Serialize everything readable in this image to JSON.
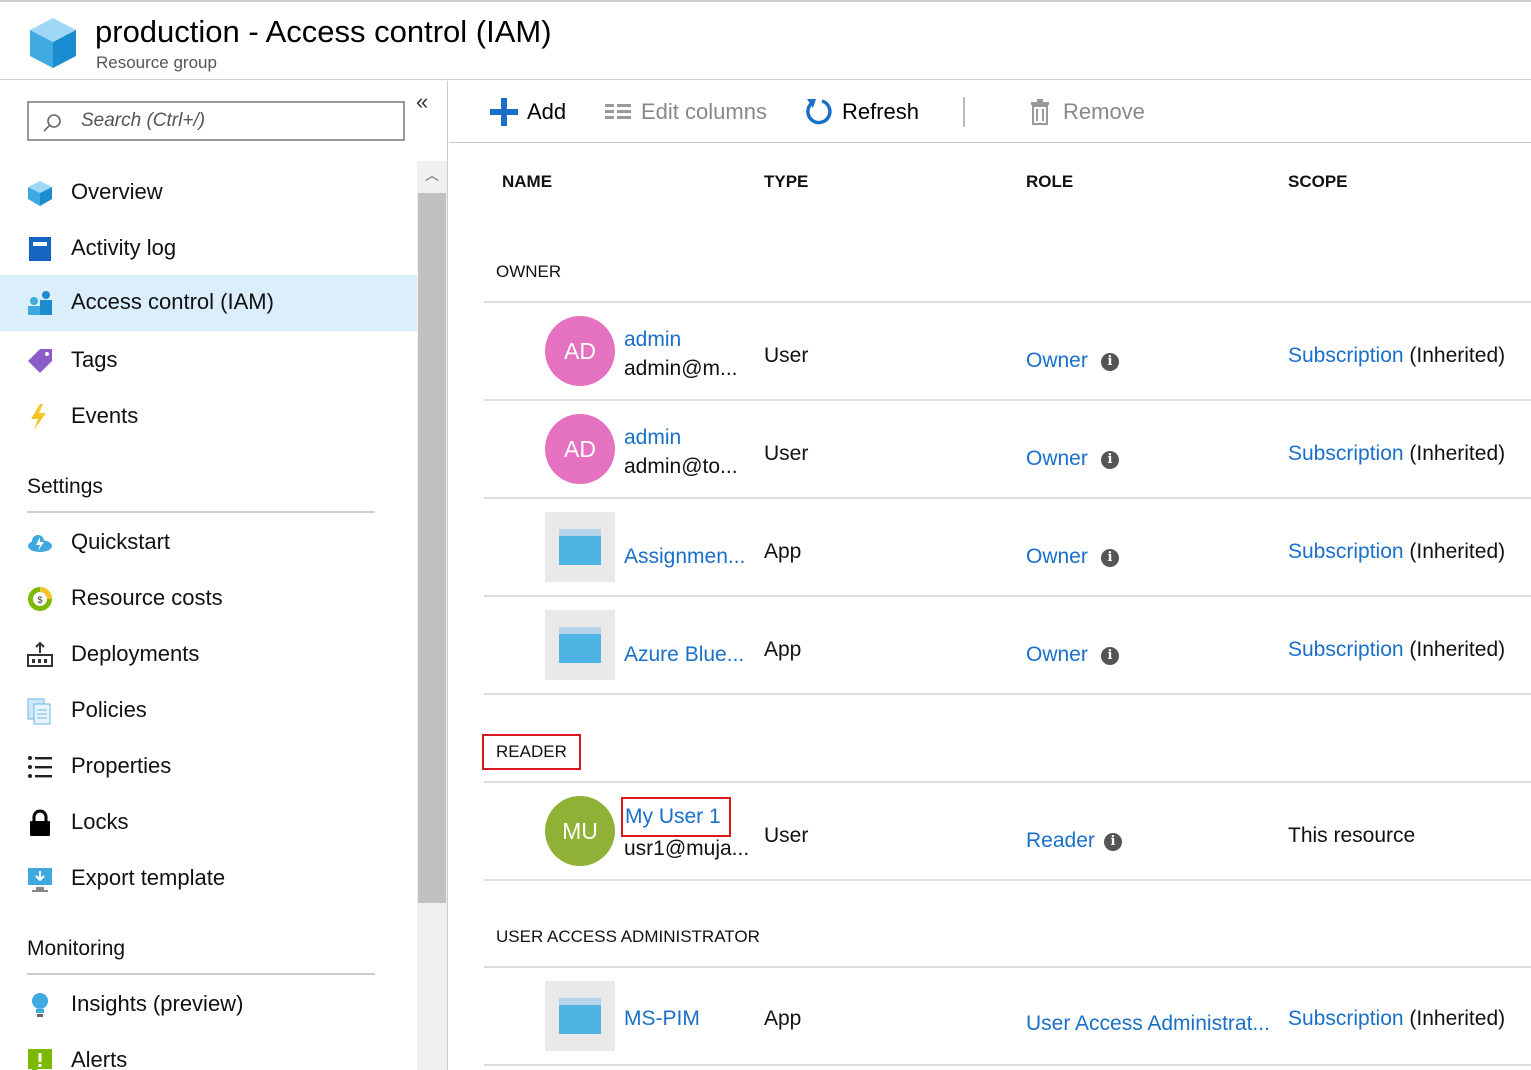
{
  "header": {
    "title": "production - Access control (IAM)",
    "subtitle": "Resource group"
  },
  "search": {
    "placeholder": "Search (Ctrl+/)"
  },
  "sidebar": {
    "items": [
      {
        "label": "Overview",
        "icon": "cube-icon"
      },
      {
        "label": "Activity log",
        "icon": "activity-log-icon"
      },
      {
        "label": "Access control (IAM)",
        "icon": "people-icon",
        "active": true
      },
      {
        "label": "Tags",
        "icon": "tag-icon"
      },
      {
        "label": "Events",
        "icon": "lightning-icon"
      }
    ],
    "settings_heading": "Settings",
    "settings_items": [
      {
        "label": "Quickstart",
        "icon": "cloud-icon"
      },
      {
        "label": "Resource costs",
        "icon": "costs-icon"
      },
      {
        "label": "Deployments",
        "icon": "deployments-icon"
      },
      {
        "label": "Policies",
        "icon": "policies-icon"
      },
      {
        "label": "Properties",
        "icon": "list-icon"
      },
      {
        "label": "Locks",
        "icon": "lock-icon"
      },
      {
        "label": "Export template",
        "icon": "export-icon"
      }
    ],
    "monitoring_heading": "Monitoring",
    "monitoring_items": [
      {
        "label": "Insights (preview)",
        "icon": "lightbulb-icon"
      },
      {
        "label": "Alerts",
        "icon": "alert-icon"
      }
    ]
  },
  "toolbar": {
    "add": "Add",
    "edit_columns": "Edit columns",
    "refresh": "Refresh",
    "remove": "Remove"
  },
  "table": {
    "headers": {
      "name": "NAME",
      "type": "TYPE",
      "role": "ROLE",
      "scope": "SCOPE"
    },
    "groups": [
      {
        "label": "OWNER",
        "rows": [
          {
            "avatar": "AD",
            "name": "admin",
            "sub": "admin@m...",
            "type": "User",
            "role": "Owner",
            "scope_link": "Subscription",
            "scope_note": "(Inherited)"
          },
          {
            "avatar": "AD",
            "name": "admin",
            "sub": "admin@to...",
            "type": "User",
            "role": "Owner",
            "scope_link": "Subscription",
            "scope_note": "(Inherited)"
          },
          {
            "avatar": "",
            "name": "Assignmen...",
            "sub": "",
            "type": "App",
            "role": "Owner",
            "scope_link": "Subscription",
            "scope_note": "(Inherited)"
          },
          {
            "avatar": "",
            "name": "Azure Blue...",
            "sub": "",
            "type": "App",
            "role": "Owner",
            "scope_link": "Subscription",
            "scope_note": "(Inherited)"
          }
        ]
      },
      {
        "label": "READER",
        "rows": [
          {
            "avatar": "MU",
            "name": "My User 1",
            "sub": "usr1@muja...",
            "type": "User",
            "role": "Reader",
            "scope_link": "",
            "scope_note": "This resource"
          }
        ]
      },
      {
        "label": "USER ACCESS ADMINISTRATOR",
        "rows": [
          {
            "avatar": "",
            "name": "MS-PIM",
            "sub": "",
            "type": "App",
            "role": "User Access Administrat...",
            "scope_link": "Subscription",
            "scope_note": "(Inherited)"
          }
        ]
      }
    ]
  },
  "colors": {
    "link": "#1a6fc9",
    "avatar_pink": "#e472c0",
    "avatar_green": "#8fb136",
    "highlight_box": "#d9181f",
    "active_nav": "#dbeefc"
  }
}
